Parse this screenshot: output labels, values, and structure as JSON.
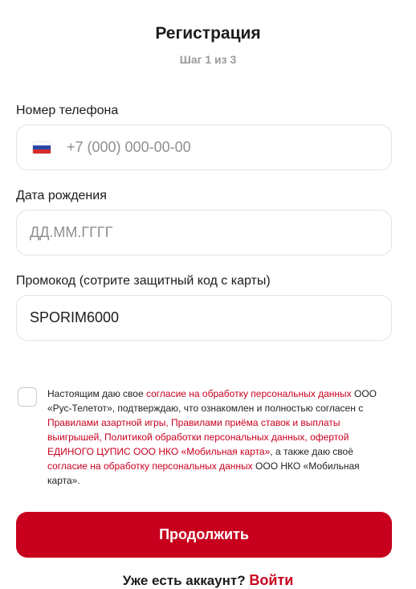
{
  "header": {
    "title": "Регистрация",
    "step": "Шаг 1 из 3"
  },
  "phone": {
    "label": "Номер телефона",
    "placeholder": "+7 (000) 000-00-00",
    "country_flag": "russia-flag-icon"
  },
  "birthdate": {
    "label": "Дата рождения",
    "placeholder": "ДД.ММ.ГГГГ"
  },
  "promo": {
    "label": "Промокод (сотрите защитный код с карты)",
    "value": "SPORIM6000"
  },
  "consent": {
    "checked": false,
    "t1": "Настоящим даю свое ",
    "l1": "согласие на обработку персональных данных",
    "t2": " ООО «Рус-Телетот», подтверждаю, что ознакомлен и полностью согласен с ",
    "l2": "Правилами азартной игры, Правилами приёма ставок и выплаты выигрышей, Политикой обработки персональных данных, офертой ЕДИНОГО ЦУПИС ООО НКО «Мобильная карта»",
    "t3": ", а также даю своё ",
    "l3": "согласие на обработку персональных данных",
    "t4": " ООО НКО «Мобильная карта»."
  },
  "actions": {
    "continue_label": "Продолжить",
    "have_account": "Уже есть аккаунт?",
    "login_label": "Войти"
  },
  "colors": {
    "accent": "#c8001e",
    "muted": "#9a9a9a",
    "border": "#e2e2e2"
  }
}
